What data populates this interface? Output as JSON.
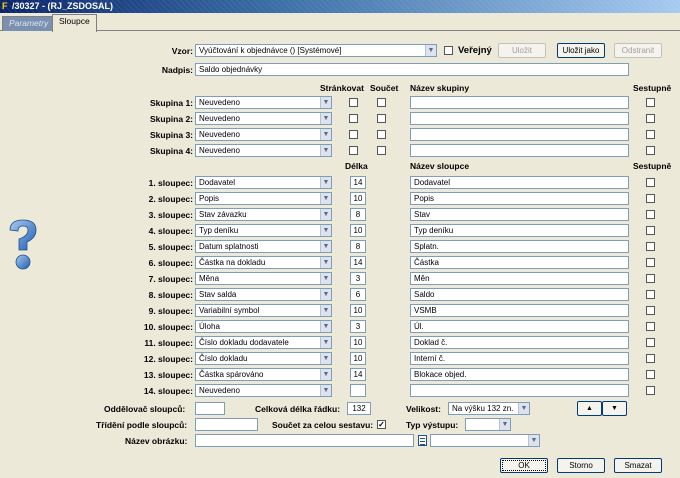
{
  "window": {
    "title": "/30327 - (RJ_ZSDOSAL)"
  },
  "tabs": [
    {
      "label": "Parametry"
    },
    {
      "label": "Sloupce"
    }
  ],
  "vzor": {
    "label": "Vzor:",
    "value": "Vyúčtování k objednávce  ()  [Systémové]"
  },
  "verejny": {
    "label": "Veřejný"
  },
  "buttons": {
    "ulozit": "Uložit",
    "ulozit_jako": "Uložit jako",
    "odstranit": "Odstranit",
    "ok": "OK",
    "storno": "Storno",
    "smazat": "Smazat",
    "up": "▲",
    "down": "▼"
  },
  "nadpis": {
    "label": "Nadpis:",
    "value": "Saldo objednávky"
  },
  "group_headers": {
    "strankovat": "Stránkovat",
    "soucet": "Součet",
    "nazev_skupiny": "Název skupiny",
    "sestupne": "Sestupně"
  },
  "groups": [
    {
      "label": "Skupina 1:",
      "value": "Neuvedeno"
    },
    {
      "label": "Skupina 2:",
      "value": "Neuvedeno"
    },
    {
      "label": "Skupina 3:",
      "value": "Neuvedeno"
    },
    {
      "label": "Skupina 4:",
      "value": "Neuvedeno"
    }
  ],
  "column_headers": {
    "delka": "Délka",
    "nazev_sloupce": "Název sloupce",
    "sestupne": "Sestupně"
  },
  "columns": [
    {
      "label": "1. sloupec:",
      "value": "Dodavatel",
      "len": "14",
      "name": "Dodavatel"
    },
    {
      "label": "2. sloupec:",
      "value": "Popis",
      "len": "10",
      "name": "Popis"
    },
    {
      "label": "3. sloupec:",
      "value": "Stav závazku",
      "len": "8",
      "name": "Stav"
    },
    {
      "label": "4. sloupec:",
      "value": "Typ deníku",
      "len": "10",
      "name": "Typ deníku"
    },
    {
      "label": "5. sloupec:",
      "value": "Datum splatnosti",
      "len": "8",
      "name": "Splatn."
    },
    {
      "label": "6. sloupec:",
      "value": "Částka na dokladu",
      "len": "14",
      "name": "Částka"
    },
    {
      "label": "7. sloupec:",
      "value": "Měna",
      "len": "3",
      "name": "Měn"
    },
    {
      "label": "8. sloupec:",
      "value": "Stav salda",
      "len": "6",
      "name": "Saldo"
    },
    {
      "label": "9. sloupec:",
      "value": "Variabilní symbol",
      "len": "10",
      "name": "VSMB"
    },
    {
      "label": "10. sloupec:",
      "value": "Úloha",
      "len": "3",
      "name": "Úl."
    },
    {
      "label": "11. sloupec:",
      "value": "Číslo dokladu dodavatele",
      "len": "10",
      "name": "Doklad č."
    },
    {
      "label": "12. sloupec:",
      "value": "Číslo dokladu",
      "len": "10",
      "name": "Interní č."
    },
    {
      "label": "13. sloupec:",
      "value": "Částka spárováno",
      "len": "14",
      "name": "Blokace objed."
    },
    {
      "label": "14. sloupec:",
      "value": "Neuvedeno",
      "len": "",
      "name": ""
    }
  ],
  "bottom": {
    "oddelovac_label": "Oddělovač sloupců:",
    "oddelovac_value": "",
    "celkova_label": "Celková délka řádku:",
    "celkova_value": "132",
    "velikost_label": "Velikost:",
    "velikost_value": "Na výšku 132 zn.",
    "trideni_label": "Třídění podle sloupců:",
    "trideni_value": "",
    "soucet_label": "Součet za celou sestavu:",
    "typ_label": "Typ výstupu:",
    "typ_value": "",
    "obrazek_label": "Název obrázku:",
    "obrazek_value": "",
    "obrazek_combo": ""
  }
}
